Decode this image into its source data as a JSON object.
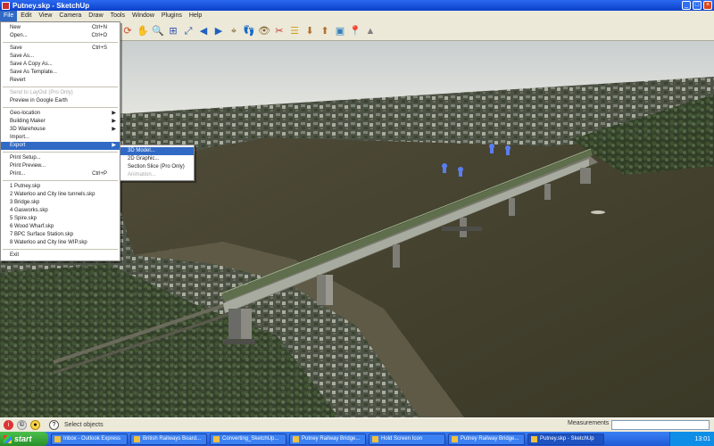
{
  "window": {
    "title": "Putney.skp - SketchUp"
  },
  "menubar": [
    "File",
    "Edit",
    "View",
    "Camera",
    "Draw",
    "Tools",
    "Window",
    "Plugins",
    "Help"
  ],
  "file_menu": {
    "items": [
      {
        "label": "New",
        "shortcut": "Ctrl+N"
      },
      {
        "label": "Open...",
        "shortcut": "Ctrl+O"
      },
      {
        "sep": true
      },
      {
        "label": "Save",
        "shortcut": "Ctrl+S"
      },
      {
        "label": "Save As..."
      },
      {
        "label": "Save A Copy As..."
      },
      {
        "label": "Save As Template..."
      },
      {
        "label": "Revert"
      },
      {
        "sep": true
      },
      {
        "label": "Send to LayOut (Pro Only)",
        "disabled": true
      },
      {
        "label": "Preview in Google Earth"
      },
      {
        "sep": true
      },
      {
        "label": "Geo-location",
        "submenu": true
      },
      {
        "label": "Building Maker",
        "submenu": true
      },
      {
        "label": "3D Warehouse",
        "submenu": true
      },
      {
        "label": "Import..."
      },
      {
        "label": "Export",
        "submenu": true,
        "highlight": true
      },
      {
        "sep": true
      },
      {
        "label": "Print Setup..."
      },
      {
        "label": "Print Preview..."
      },
      {
        "label": "Print...",
        "shortcut": "Ctrl+P"
      },
      {
        "sep": true
      },
      {
        "label": "1 Putney.skp"
      },
      {
        "label": "2 Waterloo and City line tunnels.skp"
      },
      {
        "label": "3 Bridge.skp"
      },
      {
        "label": "4 Gasworks.skp"
      },
      {
        "label": "5 Spire.skp"
      },
      {
        "label": "6 Wood Wharf.skp"
      },
      {
        "label": "7 BPC Surface Station.skp"
      },
      {
        "label": "8 Waterloo and City line WIP.skp"
      },
      {
        "sep": true
      },
      {
        "label": "Exit"
      }
    ]
  },
  "export_submenu": [
    {
      "label": "3D Model...",
      "highlight": true
    },
    {
      "label": "2D Graphic..."
    },
    {
      "label": "Section Slice (Pro Only)"
    },
    {
      "label": "Animation...",
      "disabled": true
    }
  ],
  "status": {
    "text": "Select objects",
    "measurements_label": "Measurements"
  },
  "taskbar": {
    "start_label": "start",
    "tasks": [
      "Inbox - Outlook Express",
      "British Railways Board...",
      "Converting_SketchUp...",
      "Putney Railway Bridge...",
      "Hold Screen Icon",
      "Putney Railway Bridge...",
      "Putney.skp - SketchUp"
    ],
    "clock": "13:01"
  },
  "toolbar": {
    "icons": [
      "orbit-icon",
      "pan-icon",
      "zoom-icon",
      "zoom-window-icon",
      "zoom-extents-icon",
      "previous-view-icon",
      "next-view-icon",
      "position-camera-icon",
      "walk-icon",
      "look-around-icon",
      "section-plane-icon",
      "layers-icon",
      "get-models-icon",
      "share-model-icon",
      "photo-texture-icon",
      "add-location-icon",
      "toggle-terrain-icon"
    ]
  }
}
